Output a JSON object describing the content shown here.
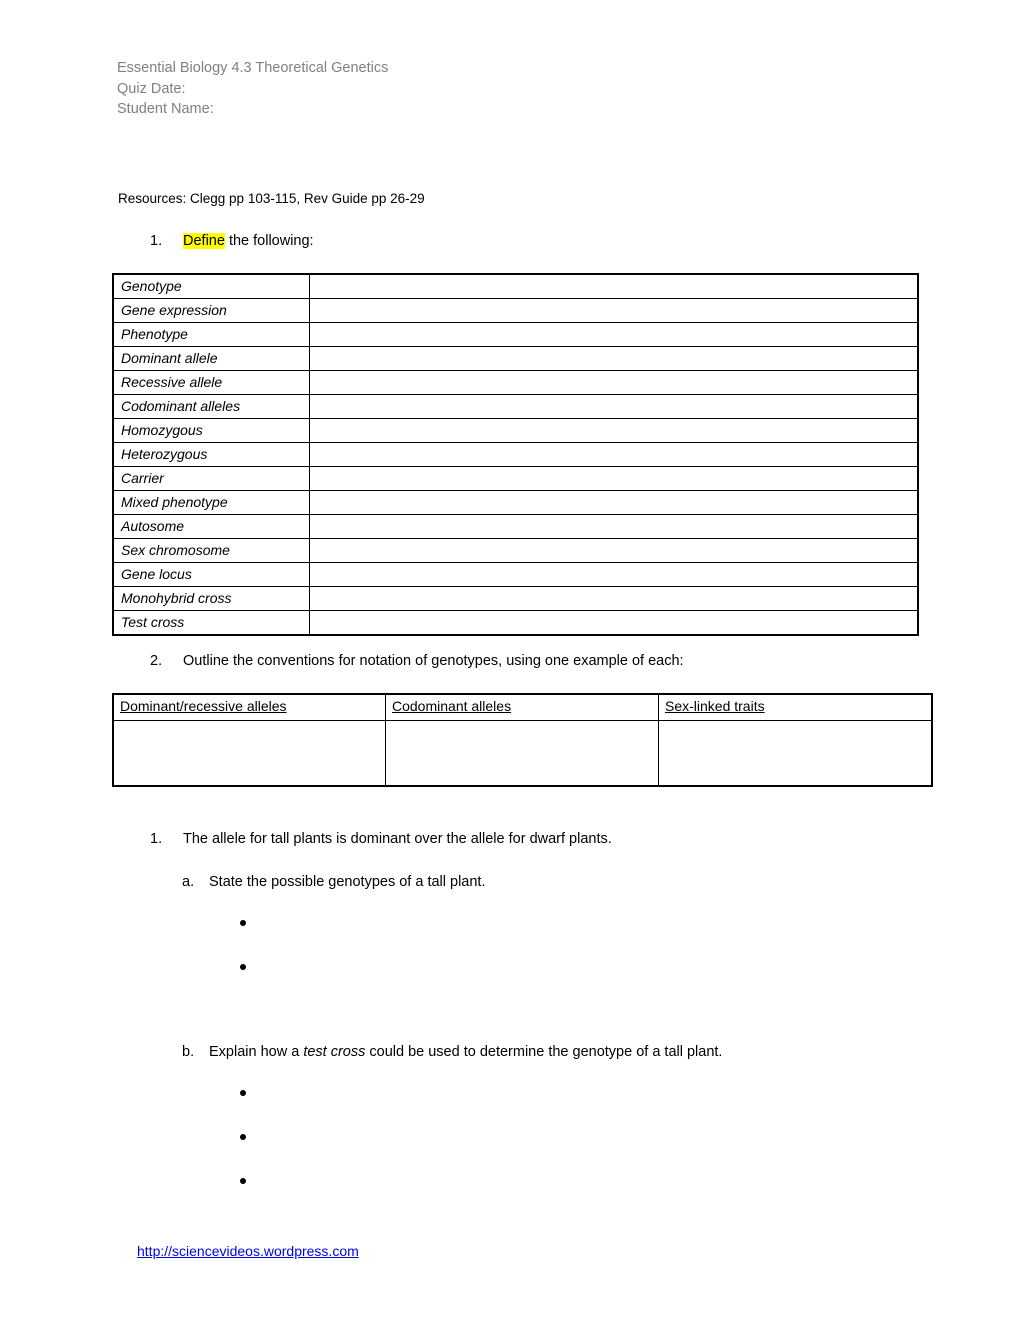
{
  "header": {
    "title": "Essential Biology 4.3 Theoretical Genetics",
    "quiz_date_label": "Quiz Date:",
    "student_name_label": "Student Name:"
  },
  "resources": {
    "text": "Resources: Clegg pp 103-115,  Rev Guide pp  26-29"
  },
  "colors": {
    "highlight": "#FFFF00",
    "header_text": "#808080",
    "link": "#0000EE",
    "border": "#000000"
  },
  "question1": {
    "marker": "1.",
    "highlighted_word": "Define",
    "rest": " the following:"
  },
  "definitions_table": {
    "rows": [
      {
        "term": "Genotype",
        "answer": ""
      },
      {
        "term": "Gene expression",
        "answer": ""
      },
      {
        "term": "Phenotype",
        "answer": ""
      },
      {
        "term": "Dominant allele",
        "answer": ""
      },
      {
        "term": "Recessive allele",
        "answer": ""
      },
      {
        "term": "Codominant alleles",
        "answer": ""
      },
      {
        "term": "Homozygous",
        "answer": ""
      },
      {
        "term": "Heterozygous",
        "answer": ""
      },
      {
        "term": "Carrier",
        "answer": ""
      },
      {
        "term": "Mixed phenotype",
        "answer": ""
      },
      {
        "term": "Autosome",
        "answer": ""
      },
      {
        "term": "Sex chromosome",
        "answer": ""
      },
      {
        "term": "Gene locus",
        "answer": ""
      },
      {
        "term": "Monohybrid cross",
        "answer": ""
      },
      {
        "term": "Test cross",
        "answer": ""
      }
    ]
  },
  "question2": {
    "marker": "2.",
    "text": "Outline the conventions for notation of genotypes, using one example of each:"
  },
  "notation_table": {
    "headers": [
      "Dominant/recessive alleles",
      "Codominant alleles",
      "Sex-linked traits"
    ],
    "answers": [
      "",
      "",
      ""
    ]
  },
  "question3": {
    "marker": "1.",
    "text": "The allele for tall plants is dominant over the allele for dwarf plants.",
    "parts": [
      {
        "marker": "a.",
        "text_before": "State the possible genotypes of a tall plant.",
        "italic": "",
        "text_after": "",
        "bullets": [
          "",
          ""
        ]
      },
      {
        "marker": "b.",
        "text_before": "Explain how a ",
        "italic": "test cross",
        "text_after": " could be used to determine the genotype of a tall plant.",
        "bullets": [
          "",
          "",
          ""
        ]
      }
    ]
  },
  "footer": {
    "link_text": "http://sciencevideos.wordpress.com"
  }
}
